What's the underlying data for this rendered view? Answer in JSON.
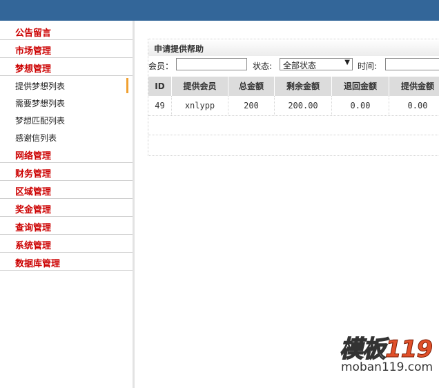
{
  "sidebar": {
    "items": [
      {
        "label": "公告留言"
      },
      {
        "label": "市场管理"
      },
      {
        "label": "梦想管理"
      },
      {
        "label": "网络管理"
      },
      {
        "label": "财务管理"
      },
      {
        "label": "区域管理"
      },
      {
        "label": "奖金管理"
      },
      {
        "label": "查询管理"
      },
      {
        "label": "系统管理"
      },
      {
        "label": "数据库管理"
      }
    ],
    "subitems": [
      {
        "label": "提供梦想列表",
        "active": true
      },
      {
        "label": "需要梦想列表"
      },
      {
        "label": "梦想匹配列表"
      },
      {
        "label": "感谢信列表"
      }
    ]
  },
  "panel": {
    "title": "申请提供帮助",
    "filter": {
      "member_label": "会员：",
      "member_value": "",
      "status_label": "状态:",
      "status_selected": "全部状态",
      "time_label": "时间:",
      "time_value": ""
    },
    "table": {
      "headers": [
        "ID",
        "提供会员",
        "总金额",
        "剩余金额",
        "退回金额",
        "提供金额"
      ],
      "rows": [
        [
          "49",
          "xnlypp",
          "200",
          "200.00",
          "0.00",
          "0.00"
        ]
      ]
    }
  },
  "watermark": {
    "brand_a": "模板",
    "brand_b": "119",
    "url": "moban119.com"
  }
}
